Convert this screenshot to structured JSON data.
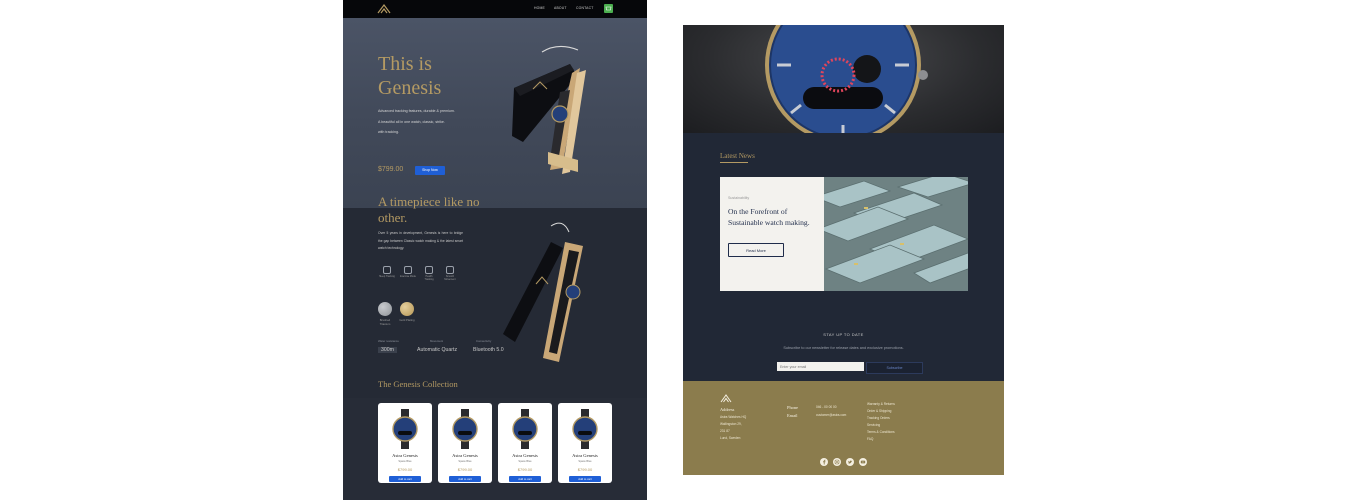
{
  "nav": {
    "links": [
      "HOME",
      "ABOUT",
      "CONTACT"
    ]
  },
  "hero": {
    "title": "This is Genesis",
    "desc_lines": [
      "Advanced tracking features, durable & premium.",
      "A beautiful all in one watch, classic, strike.",
      "with tracking."
    ],
    "price": "$799.00",
    "button": "Shop Now"
  },
  "timepiece": {
    "title": "A timepiece like no other.",
    "desc": "Over 5 years in development, Genesis is here to bridge the gap between Classic watch making & the latest smart watch technology.",
    "features": [
      {
        "label": "Sleep Tracking",
        "icon": "cloud-icon"
      },
      {
        "label": "Exercise Mode",
        "icon": "runner-icon"
      },
      {
        "label": "Health Tracking",
        "icon": "heart-icon"
      },
      {
        "label": "Smooth Movement",
        "icon": "watch-icon"
      }
    ],
    "finishes": [
      {
        "label": "Brushed Titanium",
        "color": "#9a9ea3"
      },
      {
        "label": "Gold Plating",
        "color": "#c9ae73"
      }
    ],
    "specs": [
      {
        "heading": "Water resistance",
        "value": "300m"
      },
      {
        "heading": "Movement",
        "value": "Automatic Quartz"
      },
      {
        "heading": "Connectivity",
        "value": "Bluetooth 5.0"
      }
    ]
  },
  "collection": {
    "title": "The Genesis Collection",
    "products": [
      {
        "name": "Astra Genesis",
        "variant": "Space Blue",
        "price": "$799.00",
        "button": "Add to cart"
      },
      {
        "name": "Astra Genesis",
        "variant": "Space Blue",
        "price": "$799.00",
        "button": "Add to cart"
      },
      {
        "name": "Astra Genesis",
        "variant": "Space Blue",
        "price": "$799.00",
        "button": "Add to cart"
      },
      {
        "name": "Astra Genesis",
        "variant": "Space Blue",
        "price": "$799.00",
        "button": "Add to cart"
      }
    ]
  },
  "news": {
    "title": "Latest News",
    "category": "Sustainability",
    "headline": "On the Forefront of Sustainable watch making.",
    "button": "Read More"
  },
  "newsletter": {
    "title": "STAY UP TO DATE",
    "subtitle": "Subscribe to our newsletter for release dates and exclusive promotions.",
    "placeholder": "Enter your email",
    "button": "Subscribe"
  },
  "footer": {
    "address_heading": "Address",
    "address_lines": [
      "Astra Watches HQ",
      "Wallingston 29,",
      "231 87",
      "Lund, Sweden"
    ],
    "phone_heading": "Phone",
    "phone": "046 - 00 00 00",
    "email_heading": "Email",
    "email": "customer@astra.com",
    "links": [
      "Warranty & Returns",
      "Order & Shipping",
      "Tracking Orders",
      "Servicing",
      "Terms & Conditions",
      "FAQ"
    ],
    "social": [
      "facebook-icon",
      "instagram-icon",
      "twitter-icon",
      "youtube-icon"
    ]
  },
  "colors": {
    "gold": "#b49a63",
    "navy": "#212836",
    "accent_blue": "#1f5fd6",
    "footer": "#8b7c4d"
  }
}
